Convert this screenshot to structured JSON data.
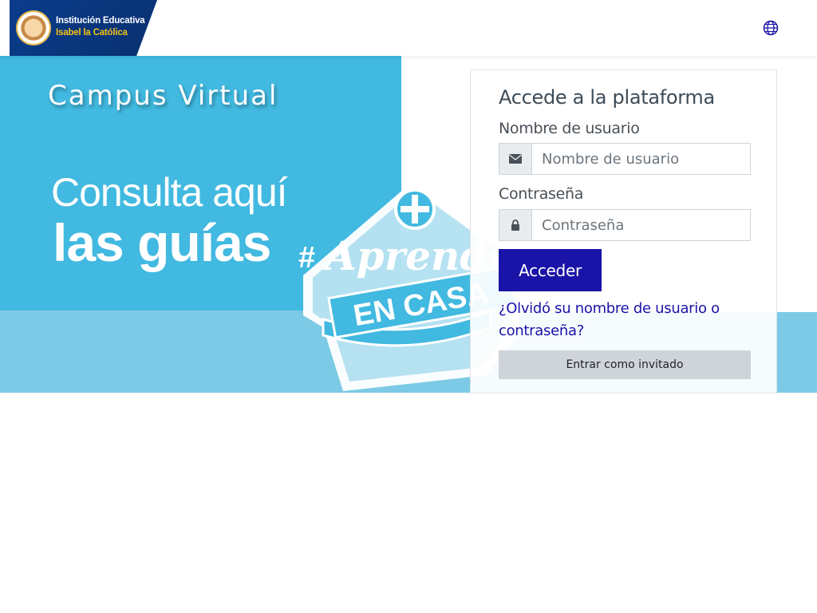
{
  "header": {
    "logo_line1": "Institución Educativa",
    "logo_line2": "Isabel la Católica",
    "language_icon": "globe-icon"
  },
  "hero": {
    "title": "Campus Virtual",
    "subtitle_line1": "Consulta aquí",
    "subtitle_line2": "las guías",
    "badge_hash": "#",
    "badge_word1": "Aprender",
    "badge_word2": "EN CASA"
  },
  "login": {
    "title": "Accede a la plataforma",
    "username_label": "Nombre de usuario",
    "username_placeholder": "Nombre de usuario",
    "username_icon": "envelope-icon",
    "password_label": "Contraseña",
    "password_placeholder": "Contraseña",
    "password_icon": "lock-icon",
    "submit_label": "Acceder",
    "forgot_link": "¿Olvidó su nombre de usuario o contraseña?",
    "guest_label": "Entrar como invitado"
  },
  "colors": {
    "primary": "#1a13a8",
    "hero_blue": "#41b9e0",
    "hero_light": "#7ccae5",
    "logo_navy": "#0b3c8c",
    "logo_gold": "#f4c21a"
  }
}
